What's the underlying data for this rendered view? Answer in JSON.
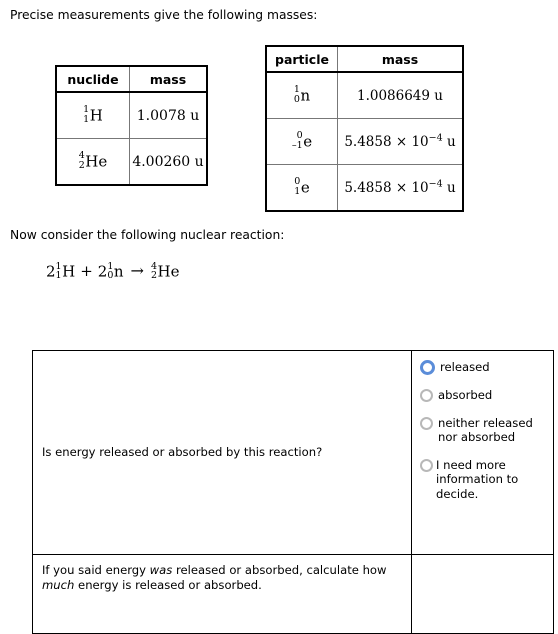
{
  "intro": {
    "text": "Precise measurements give the following masses:"
  },
  "nuclide_table": {
    "headers": [
      "nuclide",
      "mass"
    ],
    "rows": [
      {
        "nuclide": {
          "superscript": "1",
          "subscript": "1",
          "symbol": "H"
        },
        "mass": "1.0078 u"
      },
      {
        "nuclide": {
          "superscript": "4",
          "subscript": "2",
          "symbol": "He"
        },
        "mass": "4.00260 u"
      }
    ]
  },
  "particle_table": {
    "headers": [
      "particle",
      "mass"
    ],
    "rows": [
      {
        "particle": {
          "superscript": "1",
          "subscript": "0",
          "symbol": "n"
        },
        "mass": {
          "mantissa": "1.0086649",
          "unit": "u"
        }
      },
      {
        "particle": {
          "superscript": "0",
          "subscript": "–1",
          "symbol": "e"
        },
        "mass": {
          "mantissa": "5.4858",
          "times": "×",
          "base": "10",
          "exponent": "−4",
          "unit": "u"
        }
      },
      {
        "particle": {
          "superscript": "0",
          "subscript": "1",
          "symbol": "e"
        },
        "mass": {
          "mantissa": "5.4858",
          "times": "×",
          "base": "10",
          "exponent": "−4",
          "unit": "u"
        }
      }
    ]
  },
  "reaction": {
    "prompt": "Now consider the following nuclear reaction:",
    "equation": {
      "term1": {
        "coefficient": "2",
        "superscript": "1",
        "subscript": "1",
        "symbol": "H"
      },
      "operator": "+",
      "term2": {
        "coefficient": "2",
        "superscript": "1",
        "subscript": "0",
        "symbol": "n"
      },
      "arrow": "→",
      "product": {
        "coefficient": "",
        "superscript": "4",
        "subscript": "2",
        "symbol": "He"
      }
    }
  },
  "answer_table": {
    "question_row": {
      "question": "Is energy released or absorbed by this reaction?",
      "options": [
        {
          "label": "released",
          "state": "focused"
        },
        {
          "label": "absorbed",
          "state": "unselected"
        },
        {
          "label": "neither released nor absorbed",
          "state": "unselected"
        },
        {
          "label": "I need more information to decide.",
          "state": "unselected"
        }
      ]
    },
    "calc_row": {
      "line1_before": "If you said energy ",
      "line1_em": "was",
      "line1_after": " released or absorbed, calculate",
      "line2_before": "how ",
      "line2_em": "much",
      "line2_after": " energy is released or absorbed."
    }
  },
  "colors": {
    "focus_ring": "#5b8dd9",
    "radio_border": "#b8b8b8",
    "table_border": "#000000",
    "text": "#000000"
  }
}
